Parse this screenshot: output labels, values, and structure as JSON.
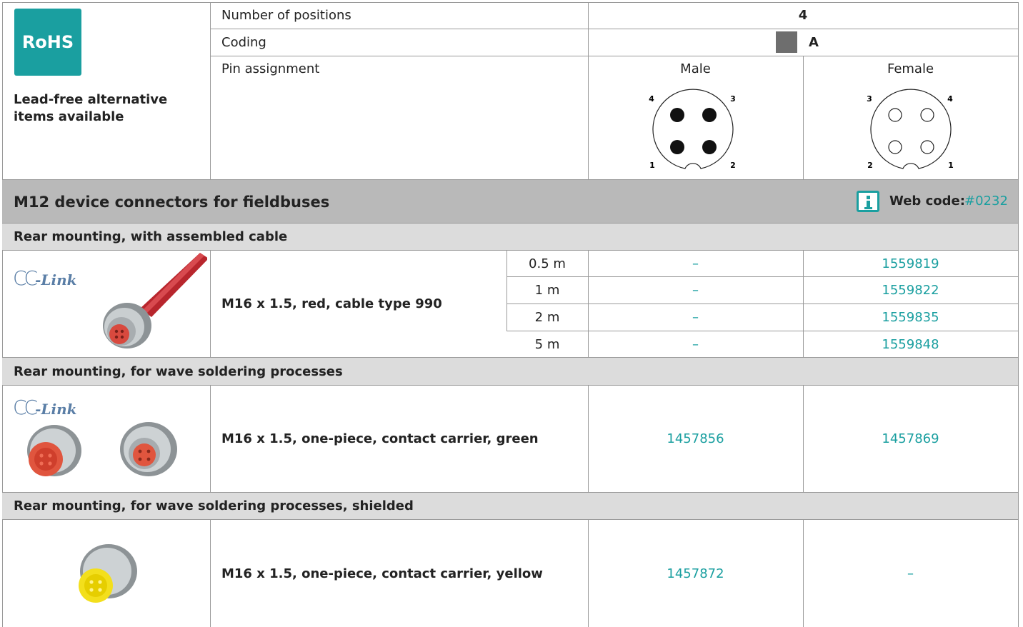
{
  "rohs": {
    "badge": "RoHS",
    "note": "Lead-free alternative items available",
    "color": "#1a9fa0"
  },
  "spec": {
    "positions_label": "Number of positions",
    "positions_value": "4",
    "coding_label": "Coding",
    "coding_value": "A",
    "pin_label": "Pin assignment",
    "male_label": "Male",
    "female_label": "Female",
    "male_pins": [
      "4",
      "3",
      "1",
      "2"
    ],
    "female_pins": [
      "3",
      "4",
      "2",
      "1"
    ]
  },
  "header": {
    "title": "M12 device connectors for fieldbuses",
    "webcode_label": "Web code:",
    "webcode_value": "#0232",
    "info_icon": "info-icon"
  },
  "sections": [
    {
      "title": "Rear mounting, with assembled cable",
      "logo": "CC-Link",
      "description": "M16 x 1.5, red, cable type 990",
      "rows": [
        {
          "length": "0.5 m",
          "male": "–",
          "female": "1559819"
        },
        {
          "length": "1 m",
          "male": "–",
          "female": "1559822"
        },
        {
          "length": "2 m",
          "male": "–",
          "female": "1559835"
        },
        {
          "length": "5 m",
          "male": "–",
          "female": "1559848"
        }
      ]
    },
    {
      "title": "Rear mounting, for wave soldering processes",
      "logo": "CC-Link",
      "description": "M16 x 1.5, one-piece, contact carrier, green",
      "male": "1457856",
      "female": "1457869"
    },
    {
      "title": "Rear mounting, for wave soldering processes, shielded",
      "description": "M16 x 1.5, one-piece, contact carrier, yellow",
      "male": "1457872",
      "female": "–"
    }
  ]
}
